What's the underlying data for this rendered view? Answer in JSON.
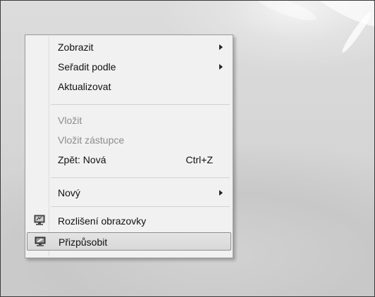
{
  "context_menu": {
    "items": [
      {
        "label": "Zobrazit",
        "submenu": true
      },
      {
        "label": "Seřadit podle",
        "submenu": true
      },
      {
        "label": "Aktualizovat"
      },
      {
        "label": "Vložit",
        "disabled": true
      },
      {
        "label": "Vložit zástupce",
        "disabled": true
      },
      {
        "label": "Zpět: Nová",
        "shortcut": "Ctrl+Z"
      },
      {
        "label": "Nový",
        "submenu": true
      },
      {
        "label": "Rozlišení obrazovky",
        "icon": "screen-resolution-icon"
      },
      {
        "label": "Přizpůsobit",
        "icon": "personalize-icon",
        "highlighted": true
      }
    ]
  },
  "colors": {
    "menu_background": "#f1f1f1",
    "disabled_text": "#8c8c8c",
    "highlight_border": "#8e8e8e"
  }
}
